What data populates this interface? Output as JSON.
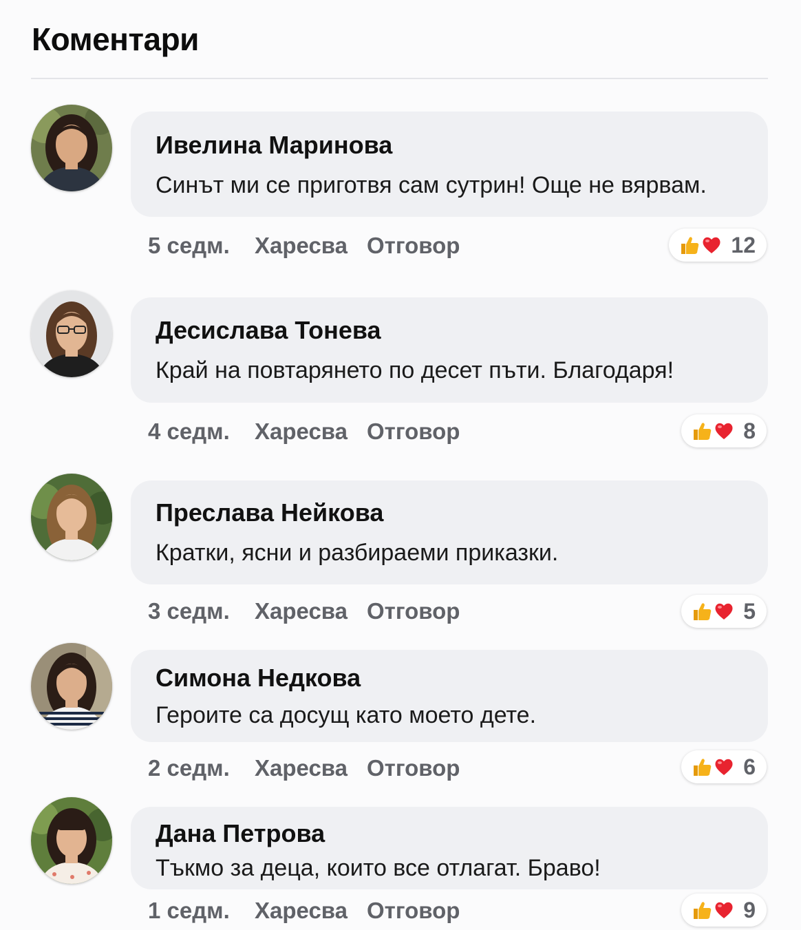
{
  "section": {
    "title": "Коментари"
  },
  "comments": [
    {
      "author": "Ивелина Маринова",
      "text": "Синът ми се приготвя сам сутрин! Още не вярвам.",
      "time": "5 седм.",
      "like_label": "Харесва",
      "reply_label": "Отговор",
      "reaction_count": "12",
      "avatar": "avatar-woman-dark-hair"
    },
    {
      "author": "Десислава Тонева",
      "text": "Край на повтарянето по десет пъти. Благодаря!",
      "time": "4 седм.",
      "like_label": "Харесва",
      "reply_label": "Отговор",
      "reaction_count": "8",
      "avatar": "avatar-woman-glasses"
    },
    {
      "author": "Преслава Нейкова",
      "text": "Кратки, ясни и разбираеми приказки.",
      "time": "3 седм.",
      "like_label": "Харесва",
      "reply_label": "Отговор",
      "reaction_count": "5",
      "avatar": "avatar-woman-long-hair"
    },
    {
      "author": "Симона Недкова",
      "text": "Героите са досущ като моето дете.",
      "time": "2 седм.",
      "like_label": "Харесва",
      "reply_label": "Отговор",
      "reaction_count": "6",
      "avatar": "avatar-woman-striped-top"
    },
    {
      "author": "Дана Петрова",
      "text": "Тъкмо за деца, които все отлагат. Браво!",
      "time": "1 седм.",
      "like_label": "Харесва",
      "reply_label": "Отговор",
      "reaction_count": "9",
      "avatar": "avatar-woman-bangs"
    }
  ],
  "reaction_icons": [
    "thumbs-up-icon",
    "heart-icon"
  ],
  "colors": {
    "bubble": "#eff0f3",
    "meta_text": "#606268",
    "heart": "#e8232f",
    "thumb": "#f6b21a"
  }
}
